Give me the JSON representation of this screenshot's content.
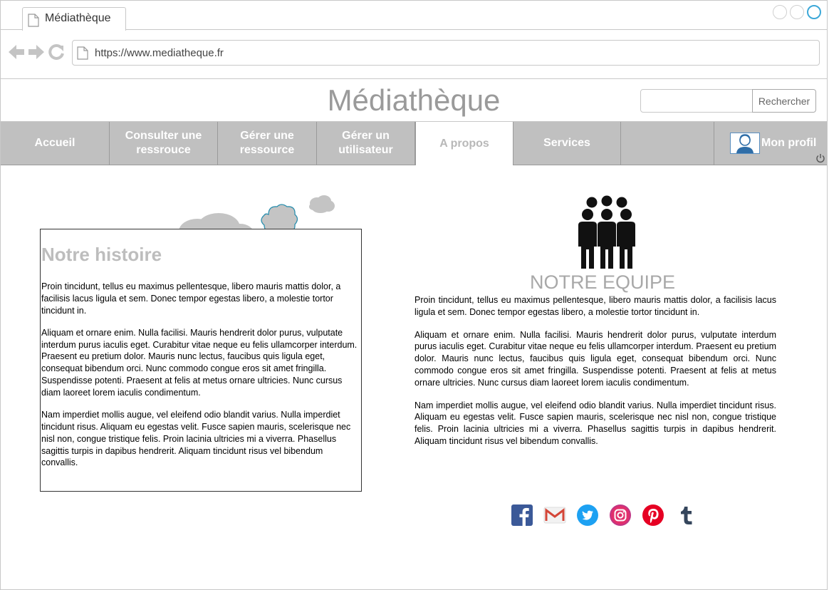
{
  "browser": {
    "tab_title": "Médiathèque",
    "url": "https://www.mediatheque.fr"
  },
  "site": {
    "title": "Médiathèque",
    "search_button": "Rechercher",
    "search_value": ""
  },
  "nav": {
    "items": [
      {
        "label": "Accueil"
      },
      {
        "label": "Consulter une ressrouce"
      },
      {
        "label": "Gérer une ressource"
      },
      {
        "label": "Gérer un utilisateur"
      },
      {
        "label": "A propos"
      },
      {
        "label": "Services"
      },
      {
        "label": ""
      }
    ],
    "active": "A propos",
    "profile_label": "Mon profil"
  },
  "history": {
    "title": "Notre histoire",
    "paragraphs": [
      "Proin tincidunt, tellus eu maximus pellentesque, libero mauris mattis dolor, a facilisis lacus ligula et sem. Donec tempor egestas libero, a molestie tortor tincidunt in.",
      "Aliquam et ornare enim. Nulla facilisi. Mauris hendrerit dolor purus, vulputate interdum purus iaculis eget. Curabitur vitae neque eu felis ullamcorper interdum. Praesent eu pretium dolor. Mauris nunc lectus, faucibus quis ligula eget, consequat bibendum orci. Nunc commodo congue eros sit amet fringilla. Suspendisse potenti. Praesent at felis at metus ornare ultricies. Nunc cursus diam laoreet lorem iaculis condimentum.",
      "Nam imperdiet mollis augue, vel eleifend odio blandit varius. Nulla imperdiet tincidunt risus. Aliquam eu egestas velit. Fusce sapien mauris, scelerisque nec nisl non, congue tristique felis. Proin lacinia ultricies mi a viverra. Phasellus sagittis turpis in dapibus hendrerit. Aliquam tincidunt risus vel bibendum convallis."
    ]
  },
  "team": {
    "title": "NOTRE EQUIPE",
    "paragraphs": [
      "Proin tincidunt, tellus eu maximus pellentesque, libero mauris mattis dolor, a facilisis lacus ligula et sem. Donec tempor egestas libero, a molestie tortor tincidunt in.",
      "Aliquam et ornare enim. Nulla facilisi. Mauris hendrerit dolor purus, vulputate interdum purus iaculis eget. Curabitur vitae neque eu felis ullamcorper interdum. Praesent eu pretium dolor. Mauris nunc lectus, faucibus quis ligula eget, consequat bibendum orci. Nunc commodo congue eros sit amet fringilla. Suspendisse potenti. Praesent at felis at metus ornare ultricies. Nunc cursus diam laoreet lorem iaculis condimentum.",
      "Nam imperdiet mollis augue, vel eleifend odio blandit varius. Nulla imperdiet tincidunt risus. Aliquam eu egestas velit. Fusce sapien mauris, scelerisque nec nisl non, congue tristique felis. Proin lacinia ultricies mi a viverra. Phasellus sagittis turpis in dapibus hendrerit. Aliquam tincidunt risus vel bibendum convallis."
    ]
  },
  "socials": [
    {
      "icon": "facebook-icon",
      "color": "#3b5998"
    },
    {
      "icon": "gmail-icon",
      "color": "#d44638"
    },
    {
      "icon": "twitter-icon",
      "color": "#1da1f2"
    },
    {
      "icon": "instagram-icon",
      "color": "#c13584"
    },
    {
      "icon": "pinterest-icon",
      "color": "#e60023"
    },
    {
      "icon": "tumblr-icon",
      "color": "#35465c"
    }
  ],
  "colors": {
    "nav_bg": "#c0c0c0",
    "title_gray": "#9a9a9a",
    "accent": "#3da8d8"
  }
}
